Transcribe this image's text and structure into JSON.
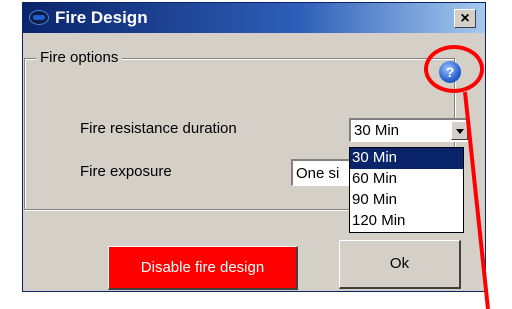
{
  "window": {
    "title": "Fire Design",
    "close_label": "×",
    "app_icon": "fire-design-app-icon"
  },
  "fire_options": {
    "group_label": "Fire options",
    "help_icon": "help-icon",
    "help_glyph": "?",
    "resistance_label": "Fire resistance duration",
    "resistance_value": "30 Min",
    "resistance_options": [
      "30 Min",
      "60 Min",
      "90 Min",
      "120 Min"
    ],
    "resistance_selected_index": 0,
    "exposure_label": "Fire exposure",
    "exposure_value": "One si"
  },
  "buttons": {
    "disable_label": "Disable fire design",
    "ok_label": "Ok"
  },
  "colors": {
    "disable_button_bg": "#ff0000",
    "highlight": "#ff0000",
    "selection_bg": "#0a246a"
  }
}
